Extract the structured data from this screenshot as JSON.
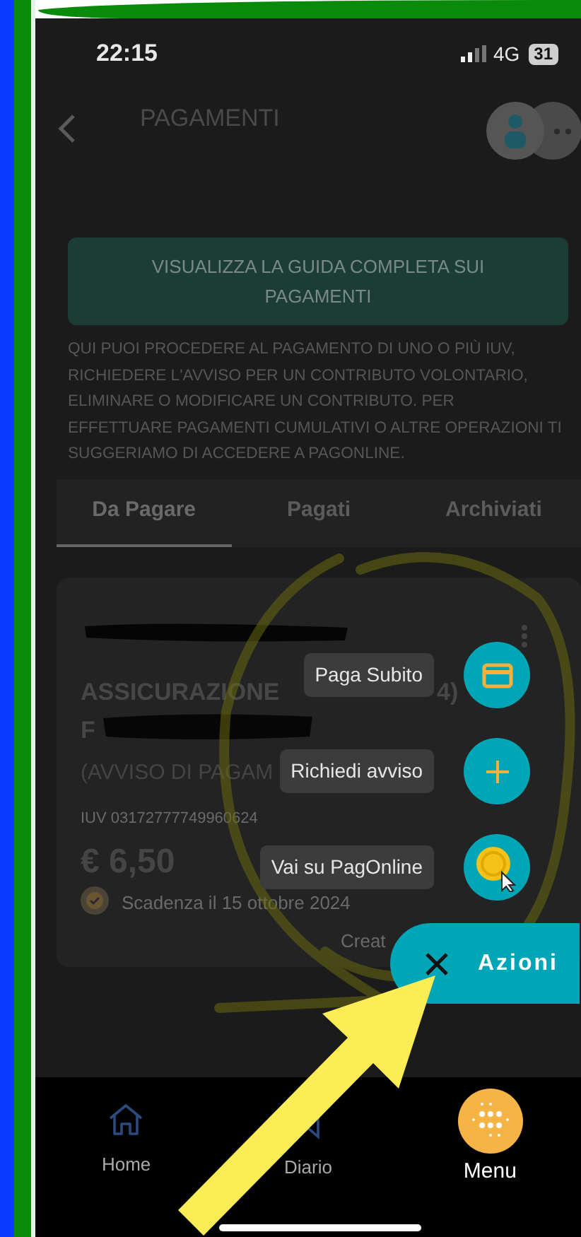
{
  "status_bar": {
    "time": "22:15",
    "network": "4G",
    "battery": "31"
  },
  "header": {
    "title": "PAGAMENTI"
  },
  "guide_button": {
    "label": "VISUALIZZA LA GUIDA COMPLETA SUI PAGAMENTI"
  },
  "description": "QUI PUOI PROCEDERE AL PAGAMENTO DI UNO O PIÙ IUV, RICHIEDERE L'AVVISO PER UN CONTRIBUTO VOLONTARIO, ELIMINARE O MODIFICARE UN CONTRIBUTO. PER EFFETTUARE PAGAMENTI CUMULATIVI O ALTRE OPERAZIONI TI SUGGERIAMO DI ACCEDERE A PAGONLINE.",
  "tabs": [
    {
      "label": "Da Pagare",
      "selected": true
    },
    {
      "label": "Pagati",
      "selected": false
    },
    {
      "label": "Archiviati",
      "selected": false
    }
  ],
  "payment_card": {
    "title_start": "ASSICURAZIONE",
    "title_end": "4)",
    "title_line_2": "F",
    "notice": "(AVVISO DI PAGAM",
    "iuv": "IUV 03172777749960624",
    "amount": "€ 6,50",
    "due": "Scadenza il 15 ottobre 2024",
    "created": "Creat"
  },
  "actions_menu": {
    "expanded": true,
    "label": "Azioni",
    "items": [
      {
        "label": "Paga Subito",
        "kind": "card"
      },
      {
        "label": "Richiedi avviso",
        "kind": "plus"
      },
      {
        "label": "Vai su PagOnline",
        "kind": "coin"
      }
    ]
  },
  "bottom_nav": [
    {
      "label": "Home",
      "kind": "home",
      "selected": false
    },
    {
      "label": "Diario",
      "kind": "bookmark",
      "selected": false
    },
    {
      "label": "Menu",
      "kind": "menu",
      "selected": true
    }
  ]
}
